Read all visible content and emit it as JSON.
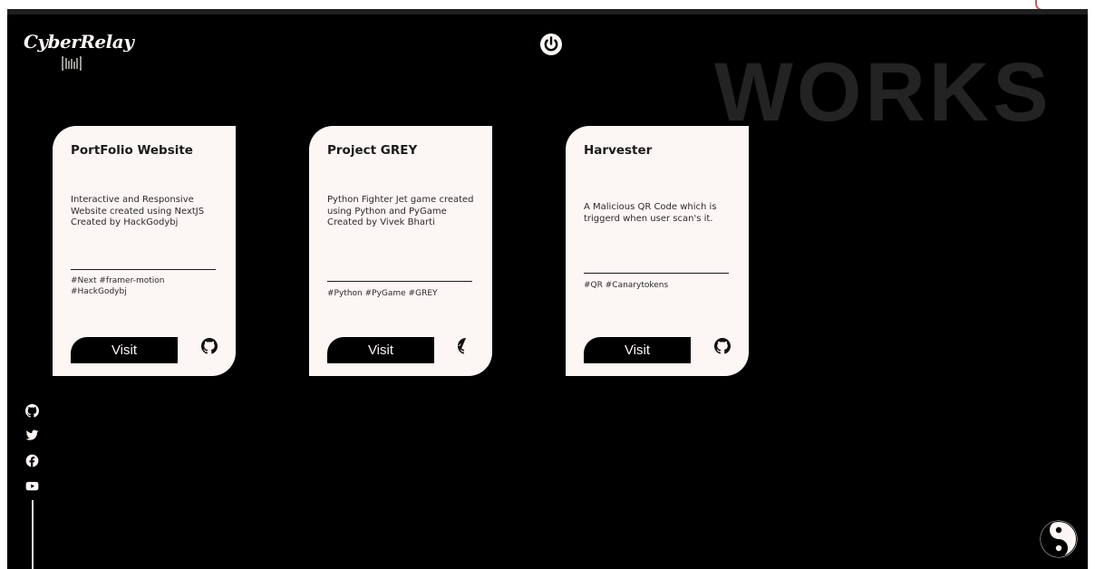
{
  "brand": {
    "name": "CyberRelay"
  },
  "hero_text": "WORKS",
  "projects": [
    {
      "title": "PortFolio Website",
      "description": "Interactive and Responsive Website created using NextJS Created by HackGodybj",
      "tags_line1": "#Next  #framer-motion",
      "tags_line2": "#HackGodybj",
      "visit_label": "Visit"
    },
    {
      "title": "Project GREY",
      "description": "Python Fighter Jet game created using Python and PyGame Created by Vivek Bharti",
      "tags_line1": "#Python  #PyGame  #GREY",
      "tags_line2": "",
      "visit_label": "Visit"
    },
    {
      "title": "Harvester",
      "description": "A Malicious QR Code which is triggerd when user scan's it.",
      "tags_line1": "#QR  #Canarytokens",
      "tags_line2": "",
      "visit_label": "Visit"
    }
  ],
  "social_icons": [
    "github-icon",
    "twitter-icon",
    "facebook-icon",
    "youtube-icon"
  ],
  "colors": {
    "background": "#000000",
    "card": "#fcf6f4",
    "accent_text": "#232323"
  }
}
